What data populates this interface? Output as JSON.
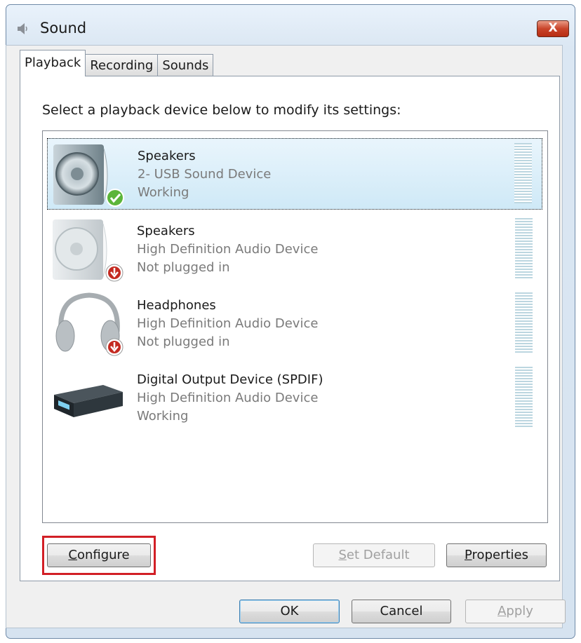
{
  "window": {
    "title": "Sound",
    "close_label": "X"
  },
  "tabs": [
    {
      "label": "Playback",
      "active": true
    },
    {
      "label": "Recording",
      "active": false
    },
    {
      "label": "Sounds",
      "active": false
    }
  ],
  "instruction": "Select a playback device below to modify its settings:",
  "devices": [
    {
      "name": "Speakers",
      "description": "2- USB Sound Device",
      "status": "Working",
      "icon": "speaker-icon",
      "badge": "check-badge-icon",
      "selected": true
    },
    {
      "name": "Speakers",
      "description": "High Definition Audio Device",
      "status": "Not plugged in",
      "icon": "speaker-icon",
      "badge": "unplugged-badge-icon",
      "selected": false
    },
    {
      "name": "Headphones",
      "description": "High Definition Audio Device",
      "status": "Not plugged in",
      "icon": "headphones-icon",
      "badge": "unplugged-badge-icon",
      "selected": false
    },
    {
      "name": "Digital Output Device (SPDIF)",
      "description": "High Definition Audio Device",
      "status": "Working",
      "icon": "digital-output-icon",
      "badge": "",
      "selected": false
    }
  ],
  "buttons": {
    "configure": {
      "accel": "C",
      "rest": "onfigure"
    },
    "set_default": {
      "accel": "S",
      "rest": "et Default"
    },
    "properties": {
      "accel": "P",
      "rest": "roperties"
    },
    "ok": "OK",
    "cancel": "Cancel",
    "apply": {
      "accel": "A",
      "rest": "pply"
    }
  },
  "colors": {
    "highlight_box": "#d21f26",
    "selected_row": "#cfe9f7",
    "status_check": "#5bb53a",
    "unplugged_badge": "#c42a21"
  }
}
